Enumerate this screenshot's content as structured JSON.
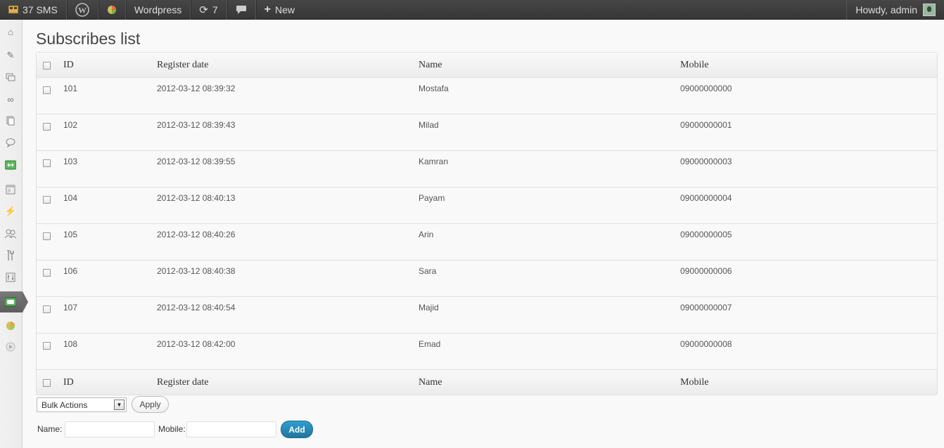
{
  "adminbar": {
    "sms_count": "37 SMS",
    "site_name": "Wordpress",
    "updates_count": "7",
    "new_label": "New",
    "howdy": "Howdy, admin"
  },
  "page": {
    "title": "Subscribes list"
  },
  "table": {
    "columns": {
      "id": "ID",
      "date": "Register date",
      "name": "Name",
      "mobile": "Mobile"
    },
    "rows": [
      {
        "id": "101",
        "date": "2012-03-12 08:39:32",
        "name": "Mostafa",
        "mobile": "09000000000"
      },
      {
        "id": "102",
        "date": "2012-03-12 08:39:43",
        "name": "Milad",
        "mobile": "09000000001"
      },
      {
        "id": "103",
        "date": "2012-03-12 08:39:55",
        "name": "Kamran",
        "mobile": "09000000003"
      },
      {
        "id": "104",
        "date": "2012-03-12 08:40:13",
        "name": "Payam",
        "mobile": "09000000004"
      },
      {
        "id": "105",
        "date": "2012-03-12 08:40:26",
        "name": "Arin",
        "mobile": "09000000005"
      },
      {
        "id": "106",
        "date": "2012-03-12 08:40:38",
        "name": "Sara",
        "mobile": "09000000006"
      },
      {
        "id": "107",
        "date": "2012-03-12 08:40:54",
        "name": "Majid",
        "mobile": "09000000007"
      },
      {
        "id": "108",
        "date": "2012-03-12 08:42:00",
        "name": "Emad",
        "mobile": "09000000008"
      }
    ]
  },
  "bulk": {
    "selected": "Bulk Actions",
    "apply_label": "Apply"
  },
  "form": {
    "name_label": "Name:",
    "mobile_label": "Mobile:",
    "add_label": "Add"
  },
  "colors": {
    "accent": "#21759b",
    "adminbar": "#464646"
  }
}
